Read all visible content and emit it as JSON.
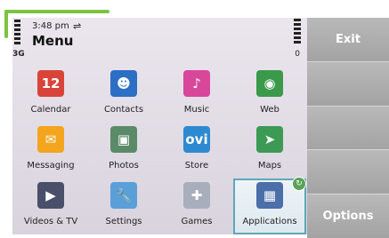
{
  "status": {
    "time": "3:48 pm",
    "network": "3G",
    "usb_glyph": "⇌",
    "battery_label": "0"
  },
  "title": "Menu",
  "apps": [
    {
      "label": "Calendar",
      "icon": "calendar-icon",
      "glyph": "12",
      "color": "#d9443a"
    },
    {
      "label": "Contacts",
      "icon": "contacts-icon",
      "glyph": "☻",
      "color": "#2d6fc4"
    },
    {
      "label": "Music",
      "icon": "music-icon",
      "glyph": "♪",
      "color": "#d8479a"
    },
    {
      "label": "Web",
      "icon": "web-globe-icon",
      "glyph": "◉",
      "color": "#3a9a4a"
    },
    {
      "label": "Messaging",
      "icon": "envelope-icon",
      "glyph": "✉",
      "color": "#f2a51d"
    },
    {
      "label": "Photos",
      "icon": "photos-icon",
      "glyph": "▣",
      "color": "#5b8a68"
    },
    {
      "label": "Store",
      "icon": "ovi-store-icon",
      "glyph": "ovi",
      "color": "#2e8ad0"
    },
    {
      "label": "Maps",
      "icon": "maps-compass-icon",
      "glyph": "➤",
      "color": "#3c9a55"
    },
    {
      "label": "Videos & TV",
      "icon": "video-icon",
      "glyph": "▶",
      "color": "#4a4f6a"
    },
    {
      "label": "Settings",
      "icon": "wrench-icon",
      "glyph": "🔧",
      "color": "#5a9fd8"
    },
    {
      "label": "Games",
      "icon": "gamepad-icon",
      "glyph": "✚",
      "color": "#a9aebd"
    },
    {
      "label": "Applications",
      "icon": "applications-icon",
      "glyph": "▦",
      "color": "#4b6fa8"
    }
  ],
  "selected_index": 11,
  "softkeys": {
    "top": "Exit",
    "bottom": "Options"
  }
}
